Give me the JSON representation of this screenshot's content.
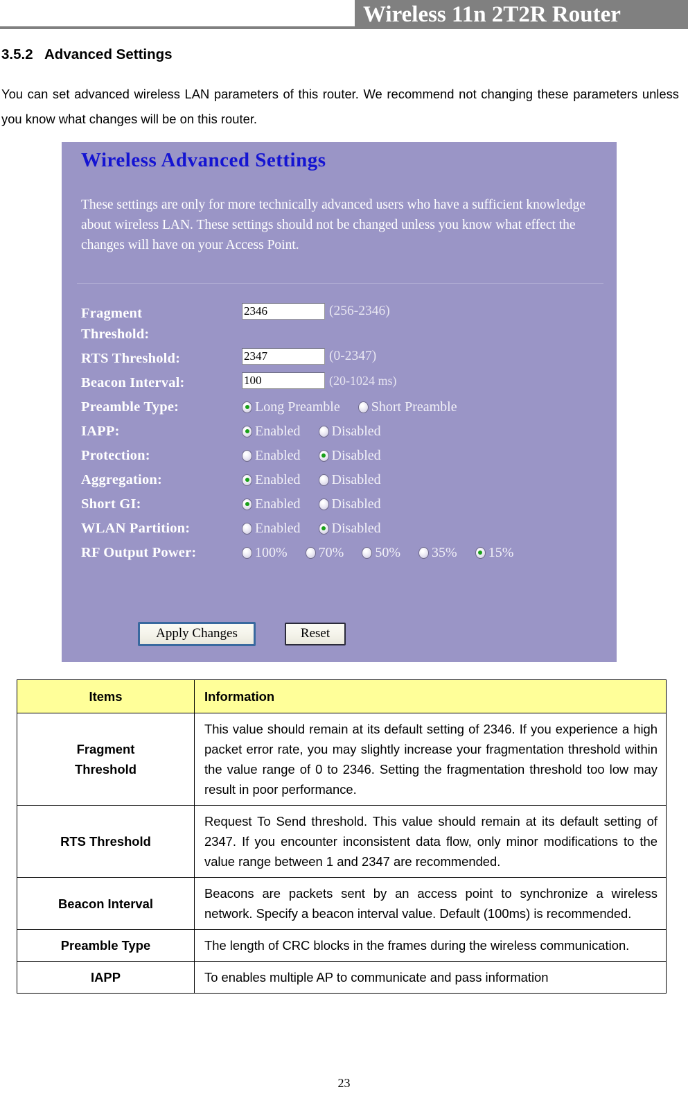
{
  "header": {
    "title": "Wireless 11n 2T2R Router"
  },
  "section": {
    "number": "3.5.2",
    "title": "Advanced Settings",
    "intro": "You can set advanced wireless LAN parameters of this router. We recommend not changing these parameters unless you know what changes will be on this router."
  },
  "panel": {
    "title": "Wireless Advanced Settings",
    "description": "These settings are only for more technically advanced users who have a sufficient knowledge about wireless LAN. These settings should not be changed unless you know what effect the changes will have on your Access Point.",
    "accent_color": "#9a95c6",
    "title_color": "#1414d2",
    "fields": {
      "fragment_threshold": {
        "label_line1": "Fragment",
        "label_line2": "Threshold:",
        "value": "2346",
        "hint": "(256-2346)"
      },
      "rts_threshold": {
        "label": "RTS Threshold:",
        "value": "2347",
        "hint": "(0-2347)"
      },
      "beacon_interval": {
        "label": "Beacon Interval:",
        "value": "100",
        "hint": "(20-1024 ms)"
      },
      "preamble_type": {
        "label": "Preamble Type:",
        "options": [
          "Long Preamble",
          "Short Preamble"
        ],
        "selected": "Long Preamble"
      },
      "iapp": {
        "label": "IAPP:",
        "options": [
          "Enabled",
          "Disabled"
        ],
        "selected": "Enabled"
      },
      "protection": {
        "label": "Protection:",
        "options": [
          "Enabled",
          "Disabled"
        ],
        "selected": "Disabled"
      },
      "aggregation": {
        "label": "Aggregation:",
        "options": [
          "Enabled",
          "Disabled"
        ],
        "selected": "Enabled"
      },
      "short_gi": {
        "label": "Short GI:",
        "options": [
          "Enabled",
          "Disabled"
        ],
        "selected": "Enabled"
      },
      "wlan_partition": {
        "label": "WLAN Partition:",
        "options": [
          "Enabled",
          "Disabled"
        ],
        "selected": "Disabled"
      },
      "rf_output_power": {
        "label": "RF Output Power:",
        "options": [
          "100%",
          "70%",
          "50%",
          "35%",
          "15%"
        ],
        "selected": "15%"
      }
    },
    "buttons": {
      "apply": "Apply Changes",
      "reset": "Reset"
    }
  },
  "table": {
    "headers": [
      "Items",
      "Information"
    ],
    "header_bg": "#ffff99",
    "rows": [
      {
        "item": "Fragment Threshold",
        "item_line1": "Fragment",
        "item_line2": "Threshold",
        "information": "This value should remain at its default setting of 2346. If you experience a high packet error rate, you may slightly increase your fragmentation threshold within the value range of 0 to 2346. Setting the fragmentation threshold too low may result in poor performance."
      },
      {
        "item": "RTS Threshold",
        "information": "Request To Send threshold. This value should remain at its default setting of 2347. If you encounter inconsistent data flow, only minor modifications to the value range between 1 and 2347 are recommended."
      },
      {
        "item": "Beacon Interval",
        "information": "Beacons are packets sent by an access point to synchronize a wireless network. Specify a beacon interval value. Default (100ms) is recommended."
      },
      {
        "item": "Preamble Type",
        "information": "The length of CRC blocks in the frames during the wireless communication."
      },
      {
        "item": "IAPP",
        "information": "To enables multiple AP to communicate and pass information"
      }
    ]
  },
  "footer": {
    "page_number": "23"
  }
}
